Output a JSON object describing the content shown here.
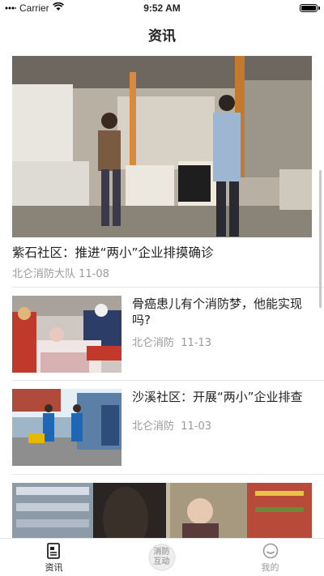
{
  "status": {
    "carrier": "Carrier",
    "time": "9:52 AM",
    "battery_level": 1.0
  },
  "nav": {
    "title": "资讯"
  },
  "feed": {
    "hero": {
      "title": "紫石社区：推进“两小”企业排摸确诊",
      "source": "北仑消防大队",
      "date": "11-08"
    },
    "items": [
      {
        "title": "骨癌患儿有个消防梦，他能实现吗?",
        "source": "北仑消防",
        "date": "11-13"
      },
      {
        "title": "沙溪社区：开展“两小”企业排查",
        "source": "北仑消防",
        "date": "11-03"
      }
    ]
  },
  "tabs": [
    {
      "label": "资讯",
      "active": true
    },
    {
      "label": "",
      "icon_text": "消防互动"
    },
    {
      "label": "我的",
      "active": false
    }
  ],
  "colors": {
    "active": "#222222",
    "inactive": "#9a9a9a",
    "meta": "#999999"
  }
}
